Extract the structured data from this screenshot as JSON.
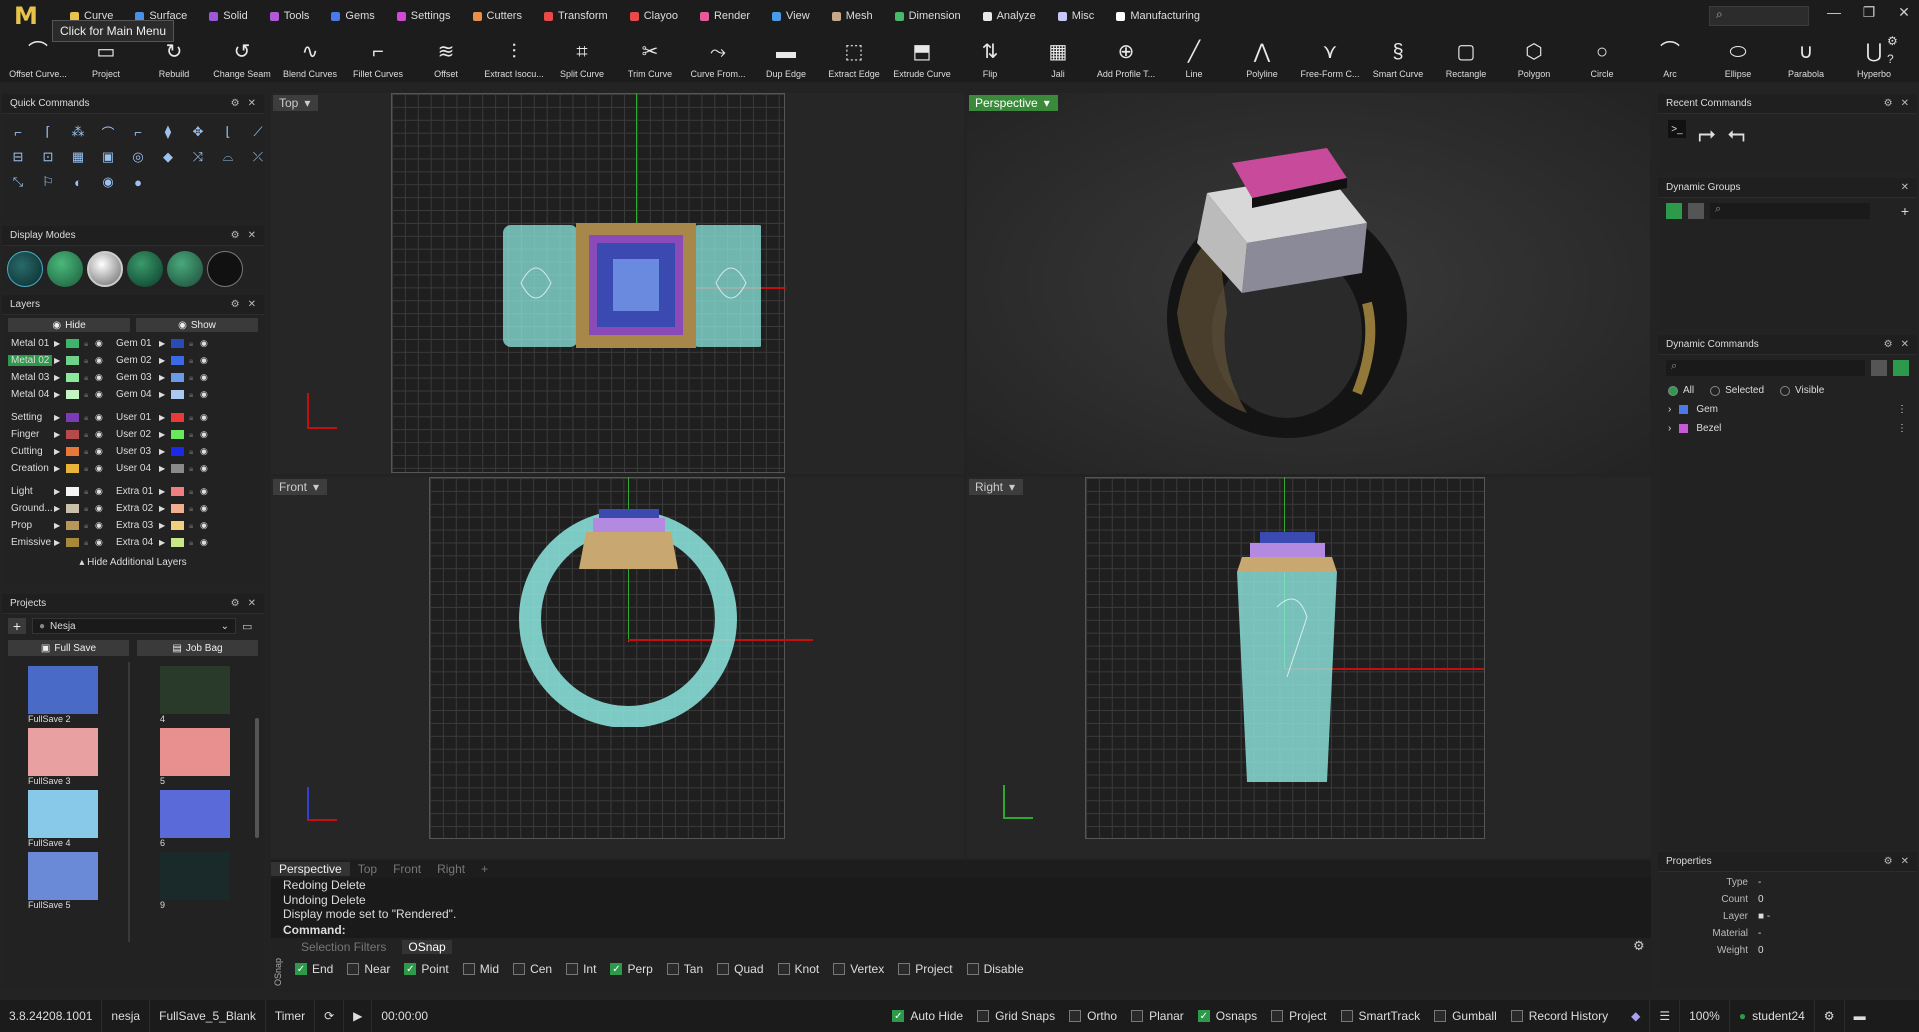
{
  "app": {
    "logo": "M",
    "tooltip": "Click for Main Menu"
  },
  "menu": [
    {
      "label": "Curve",
      "color": "#e8c24a"
    },
    {
      "label": "Surface",
      "color": "#4a8fe8"
    },
    {
      "label": "Solid",
      "color": "#9b59d8"
    },
    {
      "label": "Tools",
      "color": "#b05ad8"
    },
    {
      "label": "Gems",
      "color": "#4a7ae8"
    },
    {
      "label": "Settings",
      "color": "#d04ad8"
    },
    {
      "label": "Cutters",
      "color": "#e8904a"
    },
    {
      "label": "Transform",
      "color": "#e84a4a"
    },
    {
      "label": "Clayoo",
      "color": "#e84a4a"
    },
    {
      "label": "Render",
      "color": "#e85a9a"
    },
    {
      "label": "View",
      "color": "#4a9ae8"
    },
    {
      "label": "Mesh",
      "color": "#c8a88a"
    },
    {
      "label": "Dimension",
      "color": "#4ab86a"
    },
    {
      "label": "Analyze",
      "color": "#e8e8e8"
    },
    {
      "label": "Misc",
      "color": "#c8c8f8"
    },
    {
      "label": "Manufacturing",
      "color": "#ffffff"
    }
  ],
  "toolbar": [
    "Offset Curve...",
    "Project",
    "Rebuild",
    "Change Seam",
    "Blend Curves",
    "Fillet Curves",
    "Offset",
    "Extract Isocu...",
    "Split Curve",
    "Trim Curve",
    "Curve From...",
    "Dup Edge",
    "Extract Edge",
    "Extrude Curve",
    "Flip",
    "Jali",
    "Add Profile T...",
    "Line",
    "Polyline",
    "Free-Form C...",
    "Smart Curve",
    "Rectangle",
    "Polygon",
    "Circle",
    "Arc",
    "Ellipse",
    "Parabola",
    "Hyperbo"
  ],
  "quick_commands": {
    "title": "Quick Commands"
  },
  "display_modes": {
    "title": "Display Modes"
  },
  "layers": {
    "title": "Layers",
    "hide": "Hide",
    "show": "Show",
    "footer": "Hide Additional Layers",
    "left": [
      {
        "name": "Metal 01",
        "color": "#3db56a"
      },
      {
        "name": "Metal 02",
        "color": "#6fd18a",
        "active": true
      },
      {
        "name": "Metal 03",
        "color": "#8ee89a"
      },
      {
        "name": "Metal 04",
        "color": "#c4f3c4"
      },
      {
        "name": "Setting",
        "color": "#7b3bb5"
      },
      {
        "name": "Finger",
        "color": "#b54a4a"
      },
      {
        "name": "Cutting",
        "color": "#e8783a"
      },
      {
        "name": "Creation",
        "color": "#e8b43a"
      },
      {
        "name": "Light",
        "color": "#f4f4f4"
      },
      {
        "name": "Ground...",
        "color": "#c8c0aa"
      },
      {
        "name": "Prop",
        "color": "#b8965a"
      },
      {
        "name": "Emissive",
        "color": "#a8883a"
      }
    ],
    "right": [
      {
        "name": "Gem 01",
        "color": "#2a4ab5"
      },
      {
        "name": "Gem 02",
        "color": "#3a6ae8"
      },
      {
        "name": "Gem 03",
        "color": "#6a9ae8"
      },
      {
        "name": "Gem 04",
        "color": "#aac8f0"
      },
      {
        "name": "User 01",
        "color": "#e83a3a"
      },
      {
        "name": "User 02",
        "color": "#6ae85a"
      },
      {
        "name": "User 03",
        "color": "#1a2ae8"
      },
      {
        "name": "User 04",
        "color": "#8a8a8a"
      },
      {
        "name": "Extra 01",
        "color": "#f08080"
      },
      {
        "name": "Extra 02",
        "color": "#f0b090"
      },
      {
        "name": "Extra 03",
        "color": "#f0d080"
      },
      {
        "name": "Extra 04",
        "color": "#c8e888"
      }
    ]
  },
  "projects": {
    "title": "Projects",
    "name": "Nesja",
    "full_save": "Full Save",
    "job_bag": "Job Bag",
    "left_items": [
      "FullSave 2",
      "FullSave 3",
      "FullSave 4",
      "FullSave 5"
    ],
    "right_items": [
      "4",
      "5",
      "6",
      "9"
    ]
  },
  "viewports": {
    "top": "Top",
    "perspective": "Perspective",
    "front": "Front",
    "right": "Right"
  },
  "view_tabs": [
    "Perspective",
    "Top",
    "Front",
    "Right",
    "+"
  ],
  "command_history": [
    "Redoing Delete",
    "Undoing Delete",
    "Display mode set to \"Rendered\"."
  ],
  "command_label": "Command:",
  "osnap": {
    "tabs": [
      "Selection Filters",
      "OSnap"
    ],
    "side_label": "OSnap",
    "items": [
      {
        "label": "End",
        "on": true
      },
      {
        "label": "Near",
        "on": false
      },
      {
        "label": "Point",
        "on": true
      },
      {
        "label": "Mid",
        "on": false
      },
      {
        "label": "Cen",
        "on": false
      },
      {
        "label": "Int",
        "on": false
      },
      {
        "label": "Perp",
        "on": true
      },
      {
        "label": "Tan",
        "on": false
      },
      {
        "label": "Quad",
        "on": false
      },
      {
        "label": "Knot",
        "on": false
      },
      {
        "label": "Vertex",
        "on": false
      },
      {
        "label": "Project",
        "on": false
      },
      {
        "label": "Disable",
        "on": false
      }
    ]
  },
  "right_panels": {
    "recent": "Recent Commands",
    "groups": "Dynamic Groups",
    "commands": "Dynamic Commands",
    "filters": [
      "All",
      "Selected",
      "Visible"
    ],
    "command_items": [
      {
        "label": "Gem",
        "color": "#4a7ae8"
      },
      {
        "label": "Bezel",
        "color": "#c85ad8"
      }
    ],
    "properties": {
      "title": "Properties",
      "rows": [
        {
          "k": "Type",
          "v": "-"
        },
        {
          "k": "Count",
          "v": "0"
        },
        {
          "k": "Layer",
          "v": "■ -"
        },
        {
          "k": "Material",
          "v": "-"
        },
        {
          "k": "Weight",
          "v": "0"
        }
      ]
    }
  },
  "status": {
    "version": "3.8.24208.1001",
    "project": "nesja",
    "file": "FullSave_5_Blank",
    "timer": "Timer",
    "time": "00:00:00",
    "toggles": [
      {
        "label": "Auto Hide",
        "on": true
      },
      {
        "label": "Grid Snaps",
        "on": false
      },
      {
        "label": "Ortho",
        "on": false
      },
      {
        "label": "Planar",
        "on": false
      },
      {
        "label": "Osnaps",
        "on": true
      },
      {
        "label": "Project",
        "on": false
      },
      {
        "label": "SmartTrack",
        "on": false
      },
      {
        "label": "Gumball",
        "on": false
      },
      {
        "label": "Record History",
        "on": false
      }
    ],
    "zoom": "100%",
    "user": "student24"
  }
}
